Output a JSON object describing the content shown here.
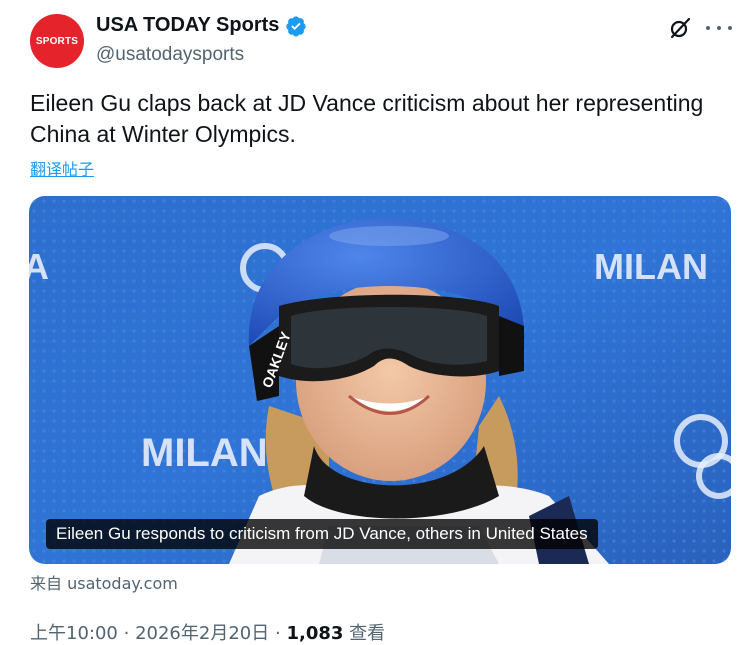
{
  "author": {
    "avatar_text": "SPORTS",
    "display_name": "USA TODAY Sports",
    "handle": "@usatodaysports",
    "verified_icon": "verified-badge-icon",
    "brand_color": "#e5232a",
    "verified_color": "#1d9bf0"
  },
  "tweet": {
    "text": "Eileen Gu claps back at JD Vance criticism about her representing China at Winter Olympics.",
    "translate_link": "翻译帖子"
  },
  "media": {
    "caption": "Eileen Gu responds to criticism from JD Vance, others in United States",
    "banner_text_left": "MILAN",
    "banner_text_right": "MILAN",
    "helmet_brand": "OAKLEY"
  },
  "source": "来自 usatoday.com",
  "meta": {
    "time": "上午10:00",
    "separator": "·",
    "date": "2026年2月20日",
    "views_count": "1,083",
    "views_label": "查看"
  },
  "actions": {
    "grok_icon": "grok-icon",
    "more_icon": "more-options-icon"
  }
}
